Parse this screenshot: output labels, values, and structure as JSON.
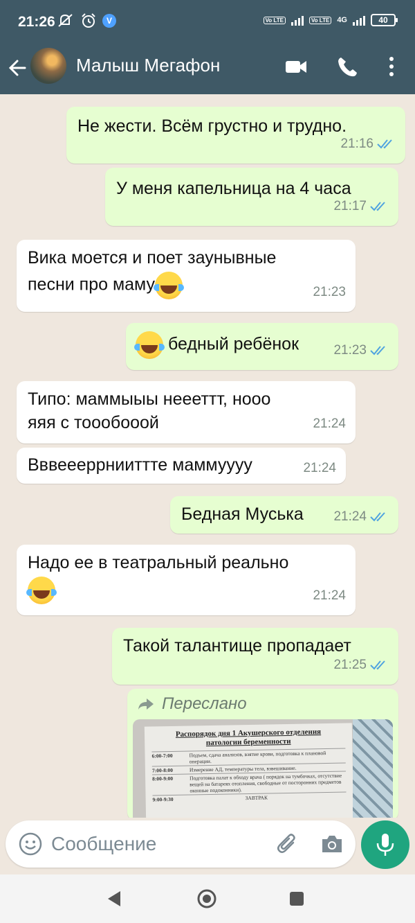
{
  "status_bar": {
    "time": "21:26",
    "battery": "40",
    "network": "4G",
    "volte": "Vo LTE",
    "verified_badge": "V"
  },
  "header": {
    "contact_name": "Малыш Мегафон"
  },
  "messages": [
    {
      "direction": "out",
      "text": "Не жести. Всём грустно и трудно.",
      "time": "21:16",
      "status": "read"
    },
    {
      "direction": "out",
      "text": "У меня капельница на 4 часа",
      "time": "21:17",
      "status": "read"
    },
    {
      "direction": "in",
      "line1": "Вика моется и поет заунывные",
      "line2": "песни про маму",
      "emoji": "face-with-tears-of-joy",
      "time": "21:23"
    },
    {
      "direction": "out",
      "text": "бедный ребёнок",
      "emoji": "rolling-on-floor-laughing",
      "time": "21:23",
      "status": "read"
    },
    {
      "direction": "in",
      "line1": "Типо: маммыыы неееттт, ноoo",
      "line2": "яяя с тоообооой",
      "time": "21:24"
    },
    {
      "direction": "in",
      "text": "Вввееерpнииттте маммуууу",
      "time": "21:24"
    },
    {
      "direction": "out",
      "text": "Бедная Муська",
      "time": "21:24",
      "status": "read"
    },
    {
      "direction": "in",
      "line1": "Надо ее в театральный реально",
      "emoji": "face-with-tears-of-joy",
      "time": "21:24"
    },
    {
      "direction": "out",
      "text": "Такой талантище пропадает",
      "time": "21:25",
      "status": "read"
    }
  ],
  "forwarded": {
    "label": "Переслано",
    "photo": {
      "title_line1": "Распорядок дня 1 Акушерского отделения",
      "title_line2": "патологии беременности",
      "rows": [
        {
          "time": "6:00-7:00",
          "text": "Подъем, сдача анализов, взятие крови, подготовка к плановой операции."
        },
        {
          "time": "7:00-8:00",
          "text": "Измерение АД, температуры тела, взвешивание."
        },
        {
          "time": "8:00-9:00",
          "text": "Подготовка палат к обходу врача ( порядок на тумбочках, отсутствие вещей на батареях отопления, свободные от посторонних предметов оконные подоконники)."
        },
        {
          "time": "9:00-9:30",
          "text": "ЗАВТРАК"
        }
      ]
    }
  },
  "input": {
    "placeholder": "Сообщение"
  },
  "colors": {
    "header": "#3f5966",
    "outgoing_bubble": "#e6fed1",
    "incoming_bubble": "#ffffff",
    "accent": "#1fa57f",
    "read_tick": "#4fa3e0"
  }
}
